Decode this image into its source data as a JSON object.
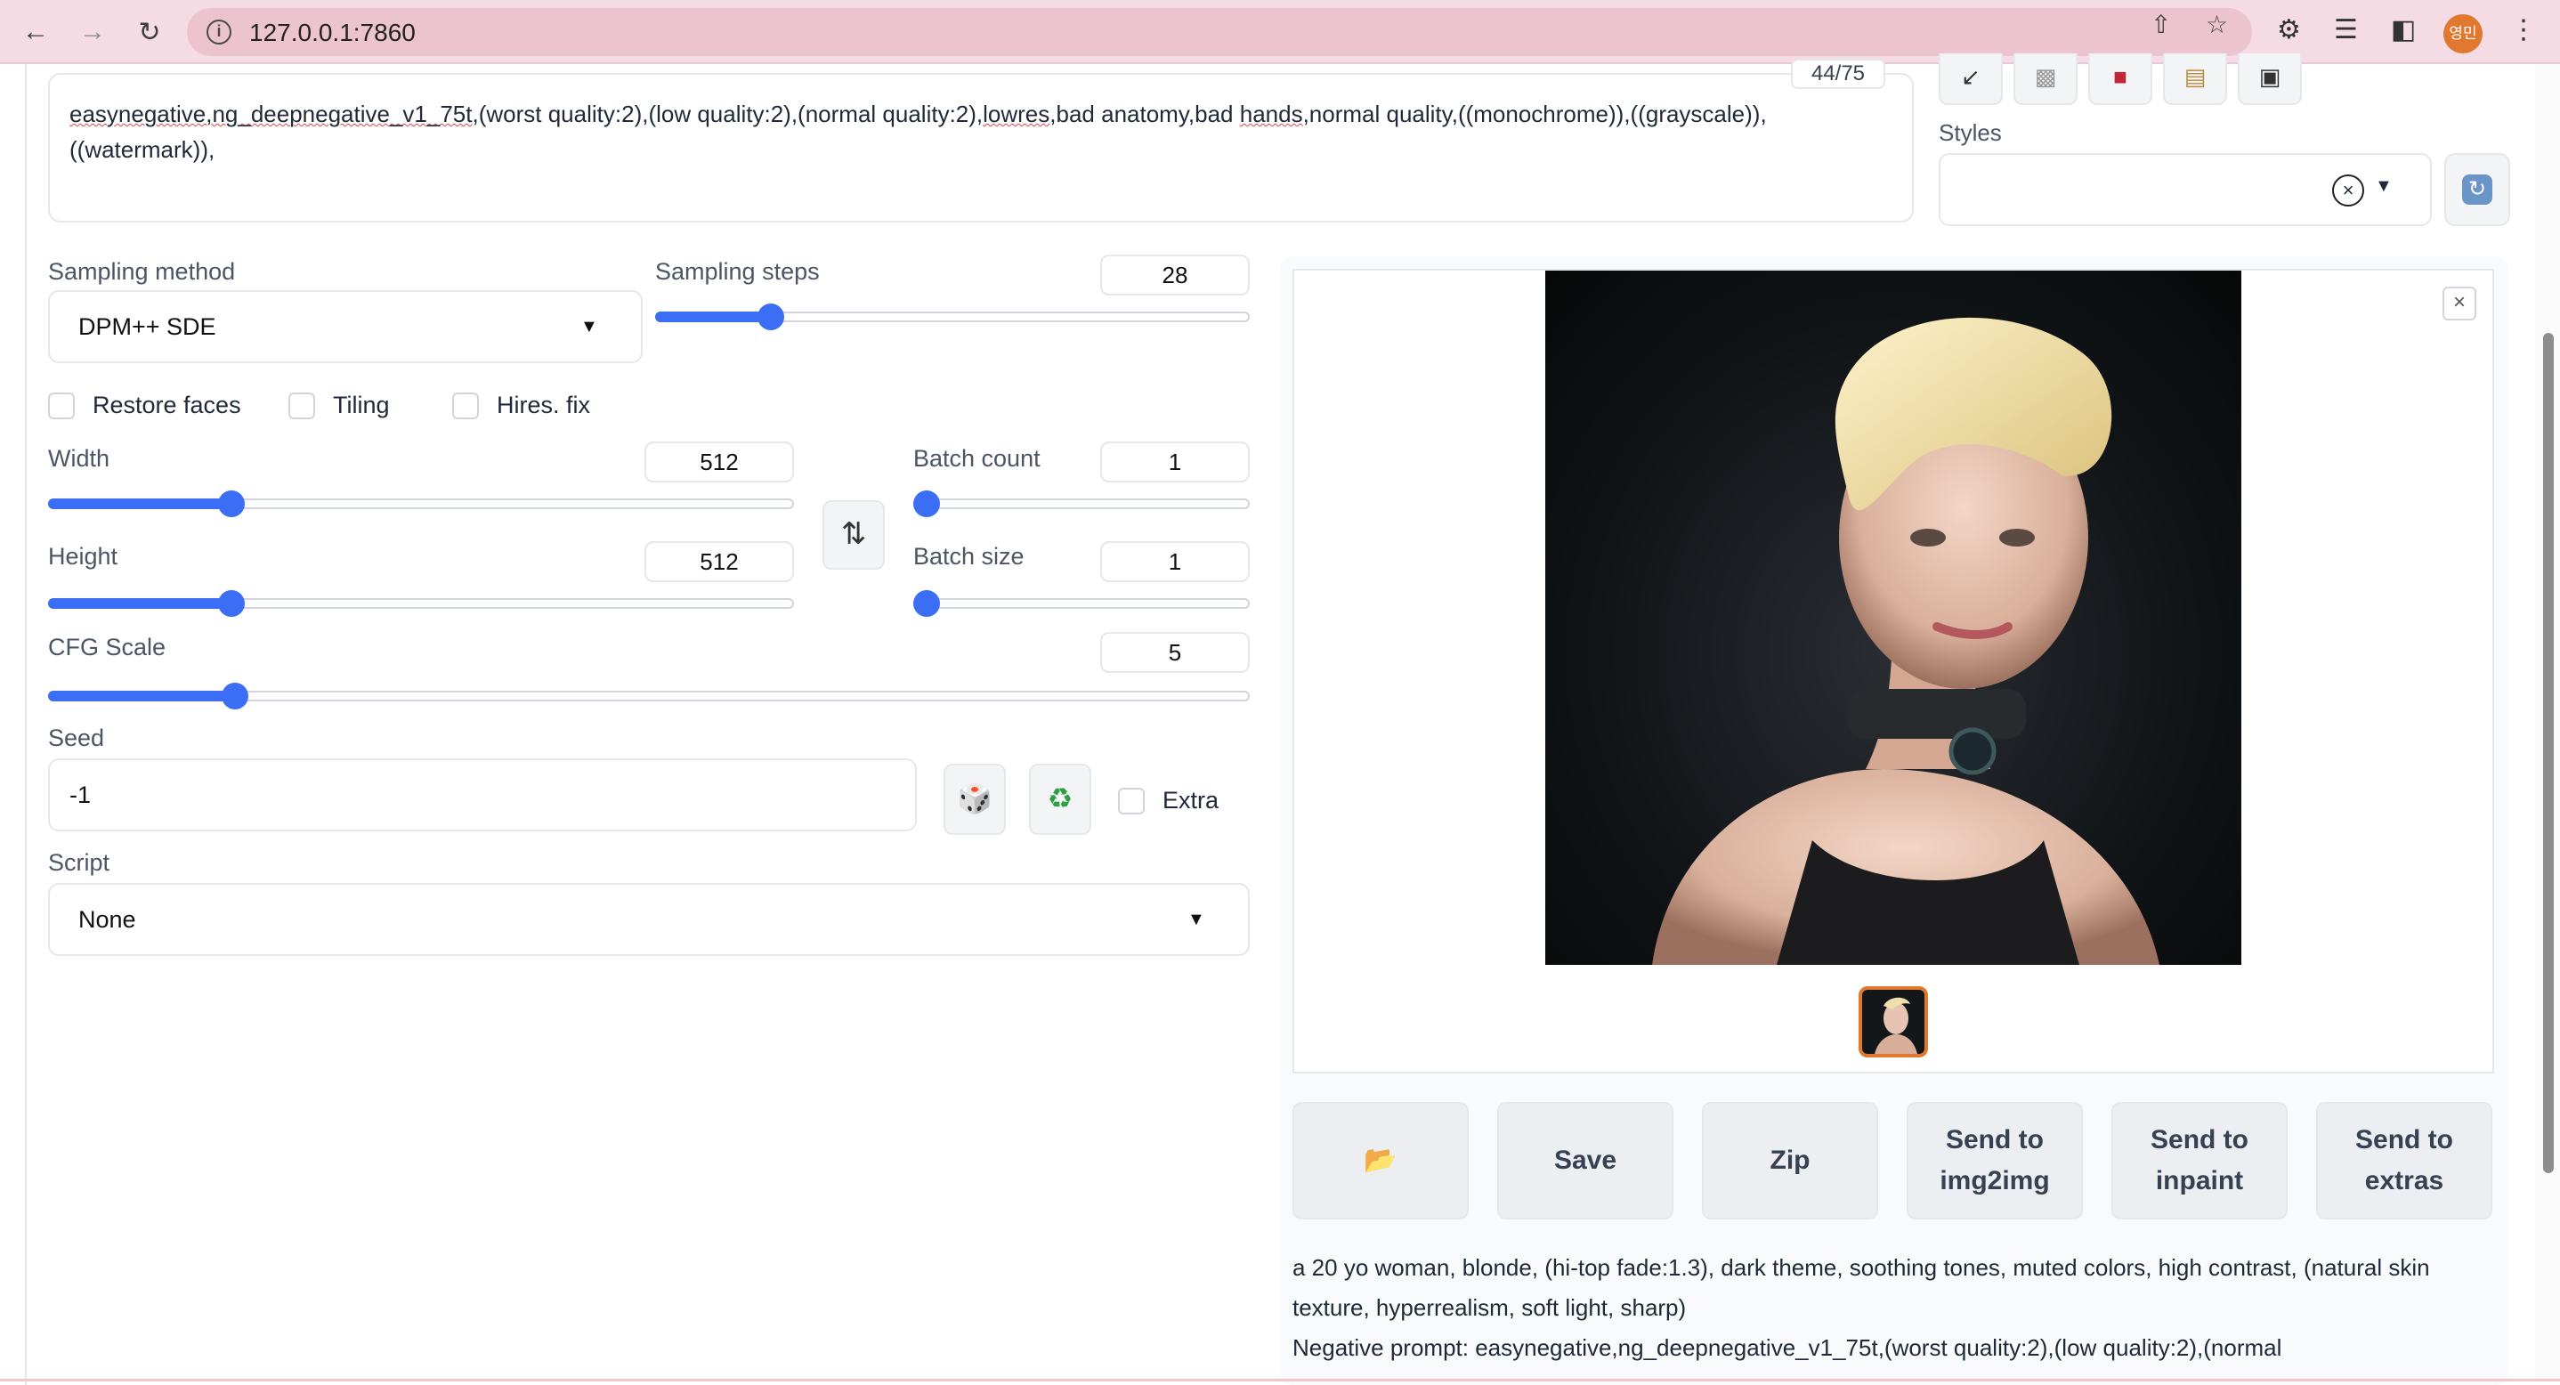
{
  "browser": {
    "url": "127.0.0.1:7860",
    "avatar_text": "영민"
  },
  "negative_prompt": {
    "text_parts": [
      {
        "text": "easynegative,ng_deepnegative_v1_75t",
        "misspelled": true
      },
      {
        "text": ",(worst quality:2),(low quality:2),(normal quality:2),",
        "misspelled": false
      },
      {
        "text": "lowres",
        "misspelled": true
      },
      {
        "text": ",bad anatomy,bad ",
        "misspelled": false
      },
      {
        "text": "hands",
        "misspelled": true
      },
      {
        "text": ",normal quality,((monochrome)),((grayscale)), ((watermark)),",
        "misspelled": false
      }
    ],
    "token_counter": "44/75"
  },
  "styles": {
    "label": "Styles",
    "value": ""
  },
  "sampling": {
    "method_label": "Sampling method",
    "method_value": "DPM++ SDE",
    "steps_label": "Sampling steps",
    "steps_value": "28",
    "steps_fraction": 0.18
  },
  "checkboxes": {
    "restore_faces": "Restore faces",
    "tiling": "Tiling",
    "hires_fix": "Hires. fix"
  },
  "size": {
    "width_label": "Width",
    "width_value": "512",
    "width_fraction": 0.236,
    "height_label": "Height",
    "height_value": "512",
    "height_fraction": 0.236
  },
  "batch": {
    "count_label": "Batch count",
    "count_value": "1",
    "size_label": "Batch size",
    "size_value": "1"
  },
  "cfg": {
    "label": "CFG Scale",
    "value": "5",
    "fraction": 0.148
  },
  "seed": {
    "label": "Seed",
    "value": "-1",
    "extra_label": "Extra"
  },
  "script": {
    "label": "Script",
    "value": "None"
  },
  "actions": {
    "folder_icon": "📂",
    "save": "Save",
    "zip": "Zip",
    "send_img2img_line1": "Send to",
    "send_img2img_line2": "img2img",
    "send_inpaint_line1": "Send to",
    "send_inpaint_line2": "inpaint",
    "send_extras_line1": "Send to",
    "send_extras_line2": "extras"
  },
  "generation_info": {
    "line1": "a 20 yo woman, blonde, (hi-top fade:1.3), dark theme, soothing tones, muted colors, high contrast, (natural skin texture, hyperrealism, soft light, sharp)",
    "line2": "Negative prompt: easynegative,ng_deepnegative_v1_75t,(worst quality:2),(low quality:2),(normal"
  },
  "colors": {
    "accent": "#3b6ef5",
    "chrome": "#f5dbe3",
    "selected_thumb": "#e0792f"
  }
}
